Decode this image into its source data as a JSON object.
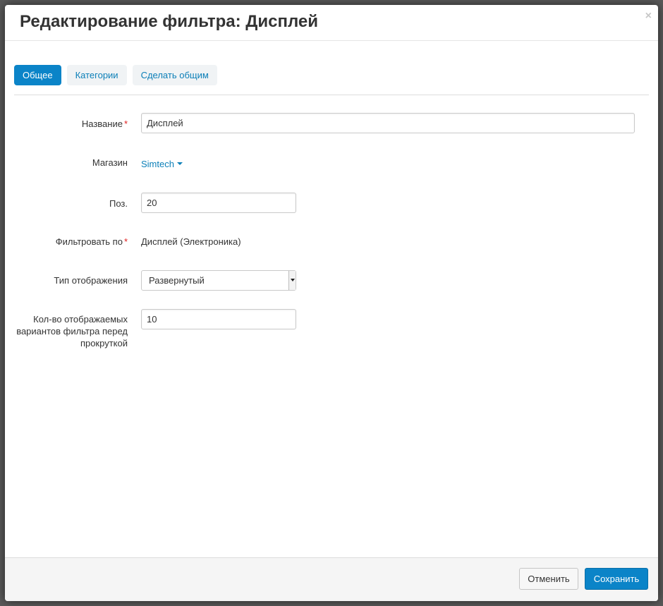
{
  "dialog": {
    "title": "Редактирование фильтра: Дисплей",
    "close_glyph": "×"
  },
  "tabs": [
    {
      "label": "Общее",
      "active": true
    },
    {
      "label": "Категории",
      "active": false
    },
    {
      "label": "Сделать общим",
      "active": false
    }
  ],
  "form": {
    "name": {
      "label": "Название",
      "required_mark": "*",
      "value": "Дисплей"
    },
    "store": {
      "label": "Магазин",
      "value": "Simtech"
    },
    "position": {
      "label": "Поз.",
      "value": "20"
    },
    "filter_by": {
      "label": "Фильтровать по",
      "required_mark": "*",
      "value": "Дисплей (Электроника)"
    },
    "display_type": {
      "label": "Тип отображения",
      "value": "Развернутый"
    },
    "variants_count": {
      "label_lines": [
        "Кол-во отображаемых",
        "вариантов фильтра перед",
        "прокруткой"
      ],
      "value": "10"
    }
  },
  "footer": {
    "cancel_label": "Отменить",
    "save_label": "Сохранить"
  },
  "colors": {
    "primary": "#0b84c8",
    "link": "#0b7fb8",
    "required": "#e02020"
  },
  "icons": {
    "close": "close-icon",
    "store_dropdown": "caret-down-icon",
    "select_arrow": "select-arrow-icon"
  }
}
